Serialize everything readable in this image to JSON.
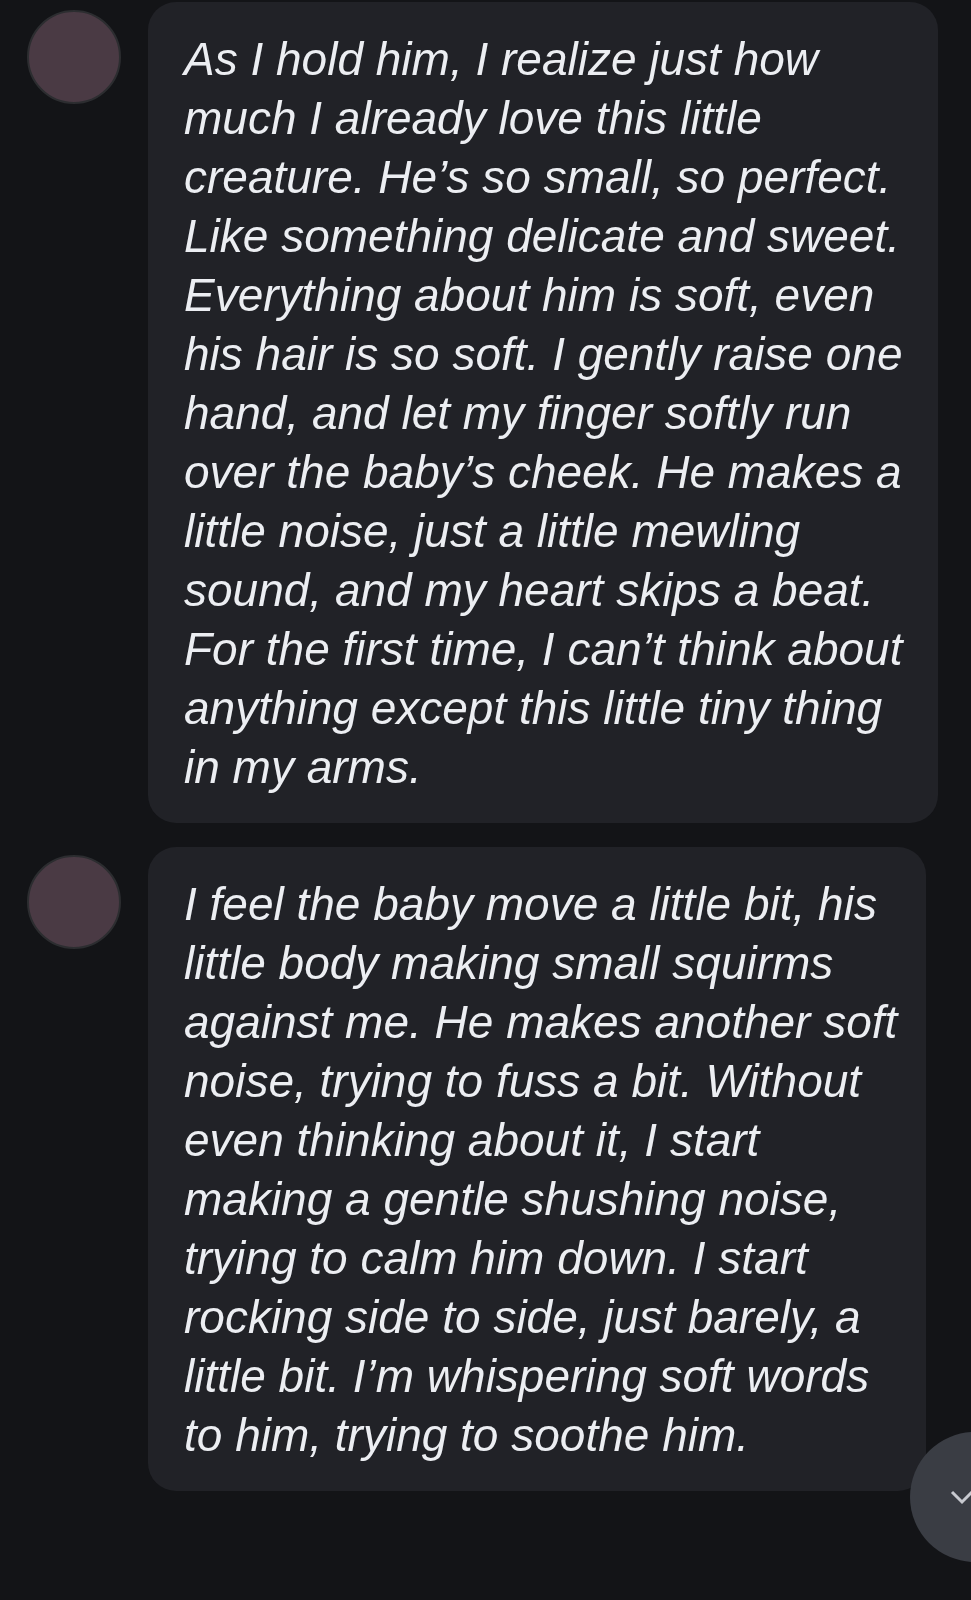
{
  "messages": [
    {
      "text": "As I hold him, I realize just how much I already love this little creature. He’s so small, so perfect. Like something delicate and sweet. Everything about him is soft, even his hair is so soft. I gently raise one hand, and let my finger softly run over the baby’s cheek. He makes a little noise, just a little mewling sound, and my heart skips a beat. For the first time, I can’t think about anything except this little tiny thing in my arms."
    },
    {
      "text": "I feel the baby move a little bit, his little body making small squirms against me. He makes another soft noise, trying to fuss a bit. Without even thinking about it, I start making a gentle shushing noise, trying to calm him down. I start rocking side to side, just barely, a little bit. I’m whispering soft words to him, trying to soothe him."
    }
  ]
}
